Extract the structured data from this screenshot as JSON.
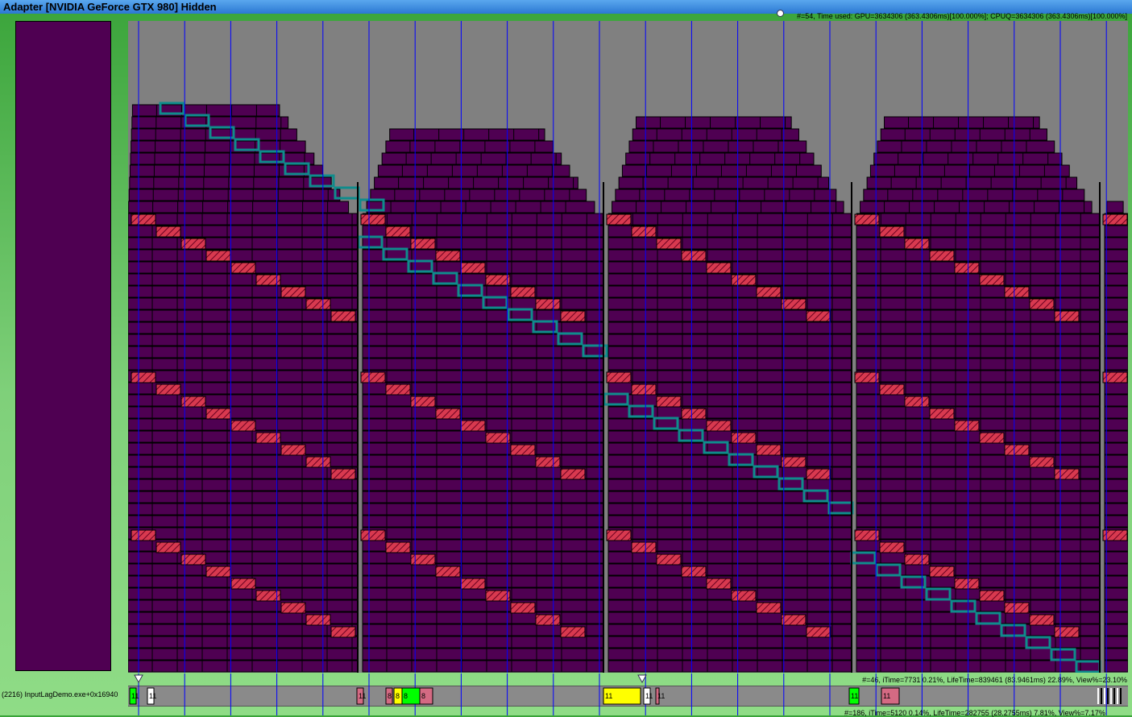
{
  "window": {
    "title": "Adapter [NVIDIA GeForce GTX 980] Hidden"
  },
  "status": {
    "top": "#=54, Time used: GPU=3634306 (363.4306ms)[100.000%]; CPUQ=3634306 (363.4306ms)[100.000%]",
    "mid": "#=46, iTime=7731  0.21%,  LifeTime=839461 (83.9461ms)  22.89%,  View%=23.10%",
    "bottom": "#=186, iTime=5120  0.14%,  LifeTime=282755 (28.2755ms)  7.81%,  View%=7.17%"
  },
  "process": {
    "label": "(2216) InputLagDemo.exe+0x16940"
  },
  "colors": {
    "packet": "#4f0052",
    "background": "#808080",
    "hatch": "#d8394f",
    "highlight": "#0f8c8c",
    "gridline": "#0000ff",
    "queue_yellow": "#ffff00",
    "queue_green": "#00ff00",
    "queue_pink": "#d46a83",
    "queue_white": "#ffffff"
  },
  "queue_packets": [
    {
      "label": "11",
      "color": "#00ff00"
    },
    {
      "label": "11",
      "color": "#ffffff"
    },
    {
      "label": "11",
      "color": "#d46a83"
    },
    {
      "label": "8",
      "color": "#d46a83"
    },
    {
      "label": "8",
      "color": "#ffff00"
    },
    {
      "label": "8",
      "color": "#00ff00"
    },
    {
      "label": "8",
      "color": "#d46a83"
    },
    {
      "label": "11",
      "color": "#ffff00"
    },
    {
      "label": "11",
      "color": "#ffffff"
    },
    {
      "label": "11",
      "color": "#d46a83"
    },
    {
      "label": "11",
      "color": "#00ff00"
    },
    {
      "label": "11",
      "color": "#d46a83"
    }
  ]
}
